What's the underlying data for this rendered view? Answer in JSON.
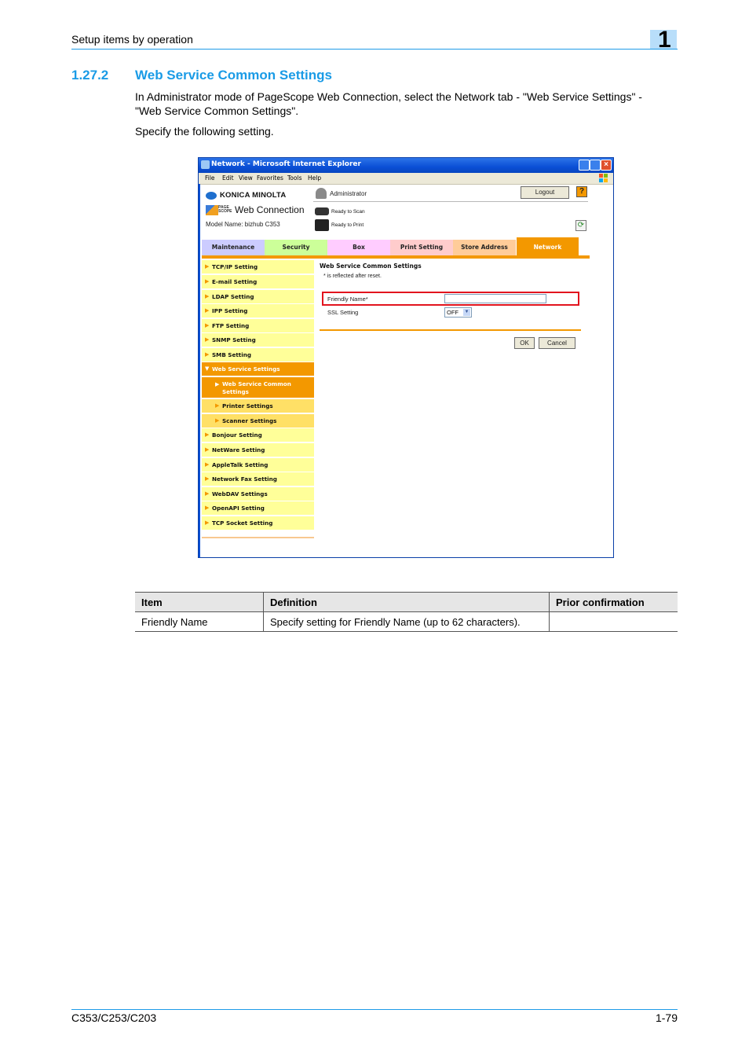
{
  "header": {
    "running_title": "Setup items by operation",
    "chapter": "1"
  },
  "section": {
    "number": "1.27.2",
    "title": "Web Service Common Settings",
    "para1_line1": "In Administrator mode of PageScope Web Connection, select the Network tab - \"Web Service Settings\" -",
    "para1_line2": "\"Web Service Common Settings\".",
    "para2": "Specify the following setting."
  },
  "screenshot": {
    "window_title": "Network - Microsoft Internet Explorer",
    "menu": [
      "File",
      "Edit",
      "View",
      "Favorites",
      "Tools",
      "Help"
    ],
    "brand": "KONICA MINOLTA",
    "product_small": "PAGE SCOPE",
    "product": "Web Connection",
    "model": "Model Name: bizhub C353",
    "user": "Administrator",
    "logout_label": "Logout",
    "help_glyph": "?",
    "status_scan": "Ready to Scan",
    "status_print": "Ready to Print",
    "refresh_glyph": "⟳",
    "tabs": [
      {
        "label": "Maintenance",
        "color": "#ccccff"
      },
      {
        "label": "Security",
        "color": "#ccff99"
      },
      {
        "label": "Box",
        "color": "#ffccff"
      },
      {
        "label": "Print Setting",
        "color": "#ffcccc"
      },
      {
        "label": "Store Address",
        "color": "#ffcc99"
      },
      {
        "label": "Network",
        "color": "#f39800",
        "active": true
      }
    ],
    "sidebar": [
      "TCP/IP Setting",
      "E-mail Setting",
      "LDAP Setting",
      "IPP Setting",
      "FTP Setting",
      "SNMP Setting",
      "SMB Setting",
      "Web Service Settings",
      "Web Service Common Settings",
      "Printer Settings",
      "Scanner Settings",
      "Bonjour Setting",
      "NetWare Setting",
      "AppleTalk Setting",
      "Network Fax Setting",
      "WebDAV Settings",
      "OpenAPI Setting",
      "TCP Socket Setting"
    ],
    "content": {
      "title": "Web Service Common Settings",
      "note": "* is reflected after reset.",
      "friendly_name_label": "Friendly Name*",
      "friendly_name_value": "",
      "ssl_label": "SSL Setting",
      "ssl_value": "OFF",
      "ok_label": "OK",
      "cancel_label": "Cancel"
    }
  },
  "table": {
    "headers": [
      "Item",
      "Definition",
      "Prior confirmation"
    ],
    "rows": [
      [
        "Friendly Name",
        "Specify setting for Friendly Name (up to 62 characters).",
        ""
      ]
    ]
  },
  "footer": {
    "model": "C353/C253/C203",
    "page": "1-79"
  },
  "colors": {
    "accent_blue": "#1a9be6",
    "network_orange": "#f39800",
    "highlight_red": "#e2141e"
  }
}
